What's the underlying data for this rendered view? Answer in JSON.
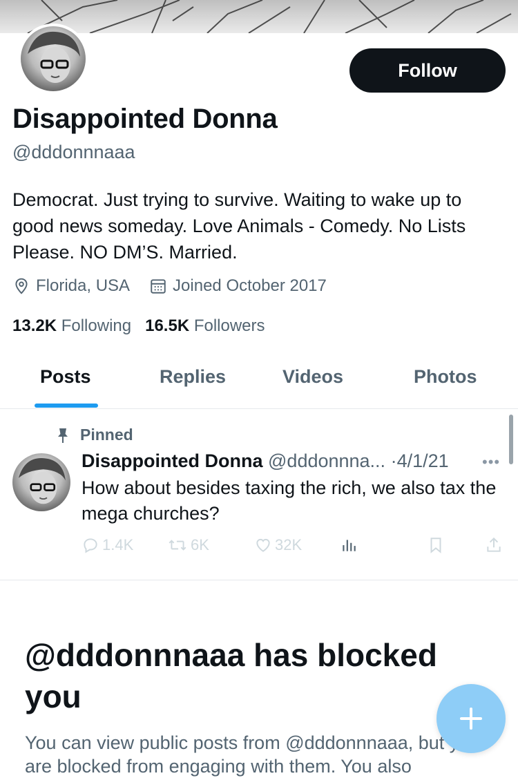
{
  "profile": {
    "name": "Disappointed Donna",
    "handle": "@dddonnnaaa",
    "bio": "Democrat. Just trying to survive. Waiting to wake up to good news someday. Love Animals - Comedy. No Lists Please. NO DM’S. Married.",
    "location": "Florida, USA",
    "joined": "Joined October 2017",
    "following_count": "13.2K",
    "following_label": "Following",
    "followers_count": "16.5K",
    "followers_label": "Followers"
  },
  "follow_button": {
    "label": "Follow"
  },
  "tabs": [
    {
      "label": "Posts",
      "active": true
    },
    {
      "label": "Replies",
      "active": false
    },
    {
      "label": "Videos",
      "active": false
    },
    {
      "label": "Photos",
      "active": false
    }
  ],
  "pinned_post": {
    "pinned_label": "Pinned",
    "author_name": "Disappointed Donna",
    "author_handle": "@dddonnna...",
    "separator": "·",
    "date": "4/1/21",
    "text": "How about besides taxing the rich, we also tax the mega churches?",
    "replies": "1.4K",
    "reposts": "6K",
    "likes": "32K",
    "icons": {
      "reply": "reply-icon",
      "repost": "repost-icon",
      "like": "heart-icon",
      "views": "views-icon",
      "bookmark": "bookmark-icon",
      "share": "share-icon"
    }
  },
  "blocked": {
    "title": "@dddonnnaaa has blocked you",
    "text": "You can view public posts from @dddonnnaaa, but you are blocked from engaging with them. You also"
  },
  "colors": {
    "accent": "#1d9bf0",
    "primary_text": "#0f1419",
    "secondary_text": "#536471",
    "fab": "#8ecdf7"
  }
}
